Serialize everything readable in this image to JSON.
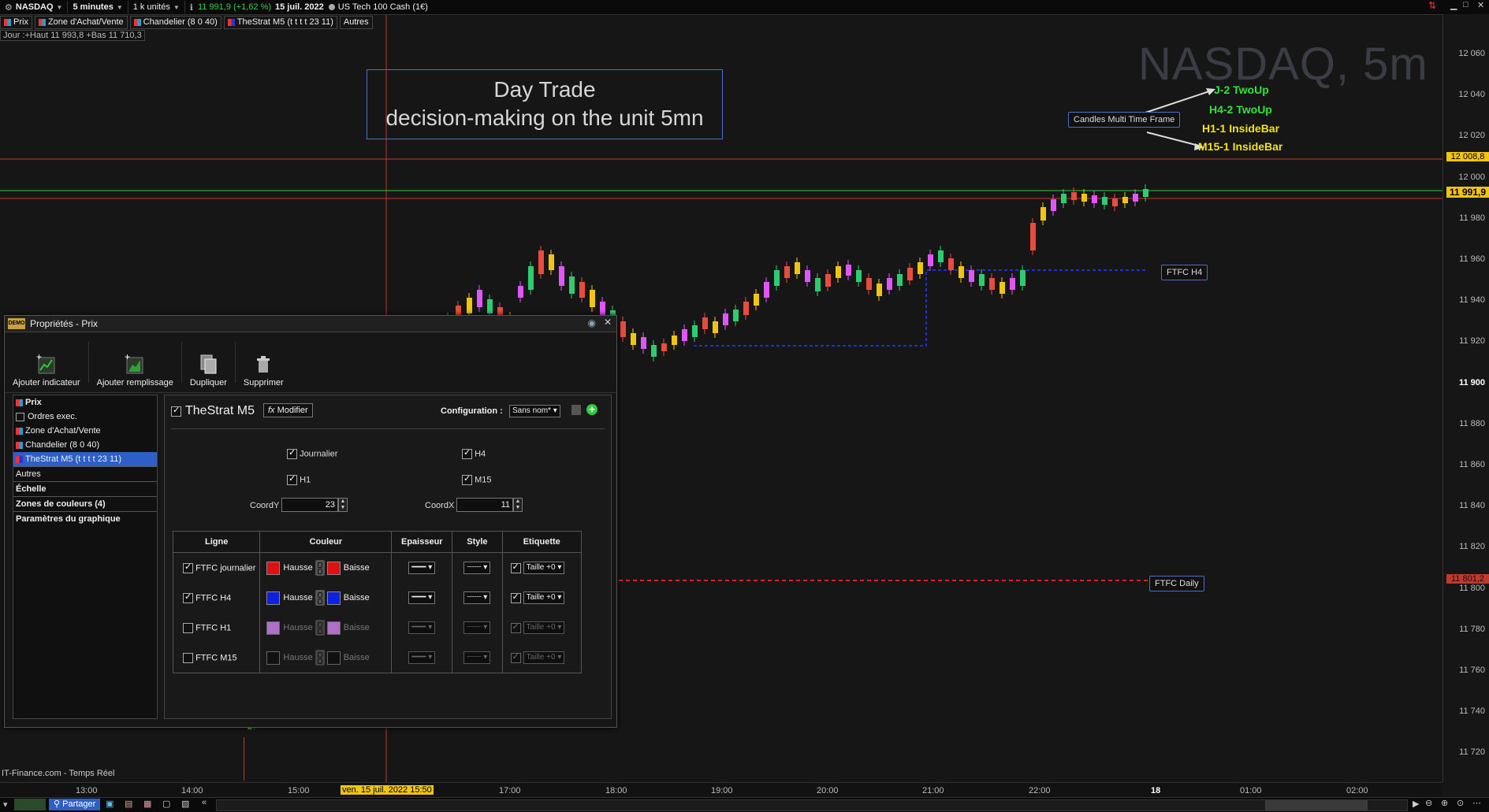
{
  "topbar": {
    "symbol": "NASDAQ",
    "timeframe": "5 minutes",
    "units": "1 k unités",
    "price_change": "11 991,9 (+1,62 %)",
    "date": "15 juil. 2022",
    "instrument": "US Tech 100 Cash (1€)"
  },
  "indicator_tags": [
    "Prix",
    "Zone d'Achat/Vente",
    "Chandelier (8 0 40)",
    "TheStrat M5 (t t t t 23 11)",
    "Autres"
  ],
  "day_info": "Jour :+Haut 11 993,8 +Bas 11 710,3",
  "chart": {
    "watermark": "NASDAQ, 5m",
    "annotation_line1": "Day Trade",
    "annotation_line2": "decision-making on the unit 5mn",
    "candles_label": "Candles Multi Time Frame",
    "ftfc_h4_label": "FTFC H4",
    "ftfc_daily_label": "FTFC Daily",
    "timeframe_labels": [
      {
        "text": "J-2 TwoUp",
        "color": "#2ee53c"
      },
      {
        "text": "H4-2 TwoUp",
        "color": "#2ee53c"
      },
      {
        "text": "H1-1 InsideBar",
        "color": "#f2e21a"
      },
      {
        "text": "M15-1 InsideBar",
        "color": "#f2e21a"
      }
    ],
    "strat_marker_low": "2↑",
    "source": "IT-Finance.com - Temps Réel"
  },
  "yaxis": {
    "ticks": [
      "12 060",
      "12 040",
      "12 020",
      "12 000",
      "11 980",
      "11 960",
      "11 940",
      "11 920",
      "11 900",
      "11 880",
      "11 860",
      "11 840",
      "11 820",
      "11 800",
      "11 780",
      "11 760",
      "11 740",
      "11 720"
    ],
    "price_label": "11 991,9",
    "level_red": "12 008,8",
    "level_daily": "11 801,2"
  },
  "xaxis": {
    "ticks": [
      "13:00",
      "14:00",
      "15:00",
      "17:00",
      "18:00",
      "19:00",
      "20:00",
      "21:00",
      "22:00",
      "18",
      "01:00",
      "02:00"
    ],
    "cursor_label": "ven. 15 juil. 2022 15:50"
  },
  "bottombar": {
    "share": "Partager"
  },
  "dialog": {
    "title": "Propriétés - Prix",
    "toolbar": [
      "Ajouter indicateur",
      "Ajouter remplissage",
      "Dupliquer",
      "Supprimer"
    ],
    "list": [
      {
        "label": "Prix",
        "bold": true
      },
      {
        "label": "Ordres exec."
      },
      {
        "label": "Zone d'Achat/Vente"
      },
      {
        "label": "Chandelier (8 0 40)"
      },
      {
        "label": "TheStrat M5 (t t t t 23 11)",
        "selected": true
      },
      {
        "label": "Autres"
      },
      {
        "label": "Échelle"
      },
      {
        "label": "Zones de couleurs (4)"
      },
      {
        "label": "Paramètres du graphique"
      }
    ],
    "panel": {
      "indicator_name": "TheStrat M5",
      "modify_label": "Modifier",
      "config_label": "Configuration :",
      "config_value": "Sans nom*",
      "cb_journalier": "Journalier",
      "cb_h4": "H4",
      "cb_h1": "H1",
      "cb_m15": "M15",
      "coordy_label": "CoordY",
      "coordy_value": "23",
      "coordx_label": "CoordX",
      "coordx_value": "11",
      "table_headers": [
        "Ligne",
        "Couleur",
        "Epaisseur",
        "Style",
        "Etiquette"
      ],
      "rows": [
        {
          "name": "FTFC journalier",
          "up": "Hausse",
          "down": "Baisse",
          "up_color": "#e01010",
          "down_color": "#e01010",
          "size": "Taille +0",
          "checked": true
        },
        {
          "name": "FTFC H4",
          "up": "Hausse",
          "down": "Baisse",
          "up_color": "#1020e0",
          "down_color": "#1020e0",
          "size": "Taille +0",
          "checked": true
        },
        {
          "name": "FTFC H1",
          "up": "Hausse",
          "down": "Baisse",
          "up_color": "#c070d0",
          "down_color": "#c070d0",
          "size": "Taille +0",
          "checked": false
        },
        {
          "name": "FTFC M15",
          "up": "Hausse",
          "down": "Baisse",
          "up_color": "#111111",
          "down_color": "#111111",
          "size": "Taille +0",
          "checked": false
        }
      ]
    }
  }
}
